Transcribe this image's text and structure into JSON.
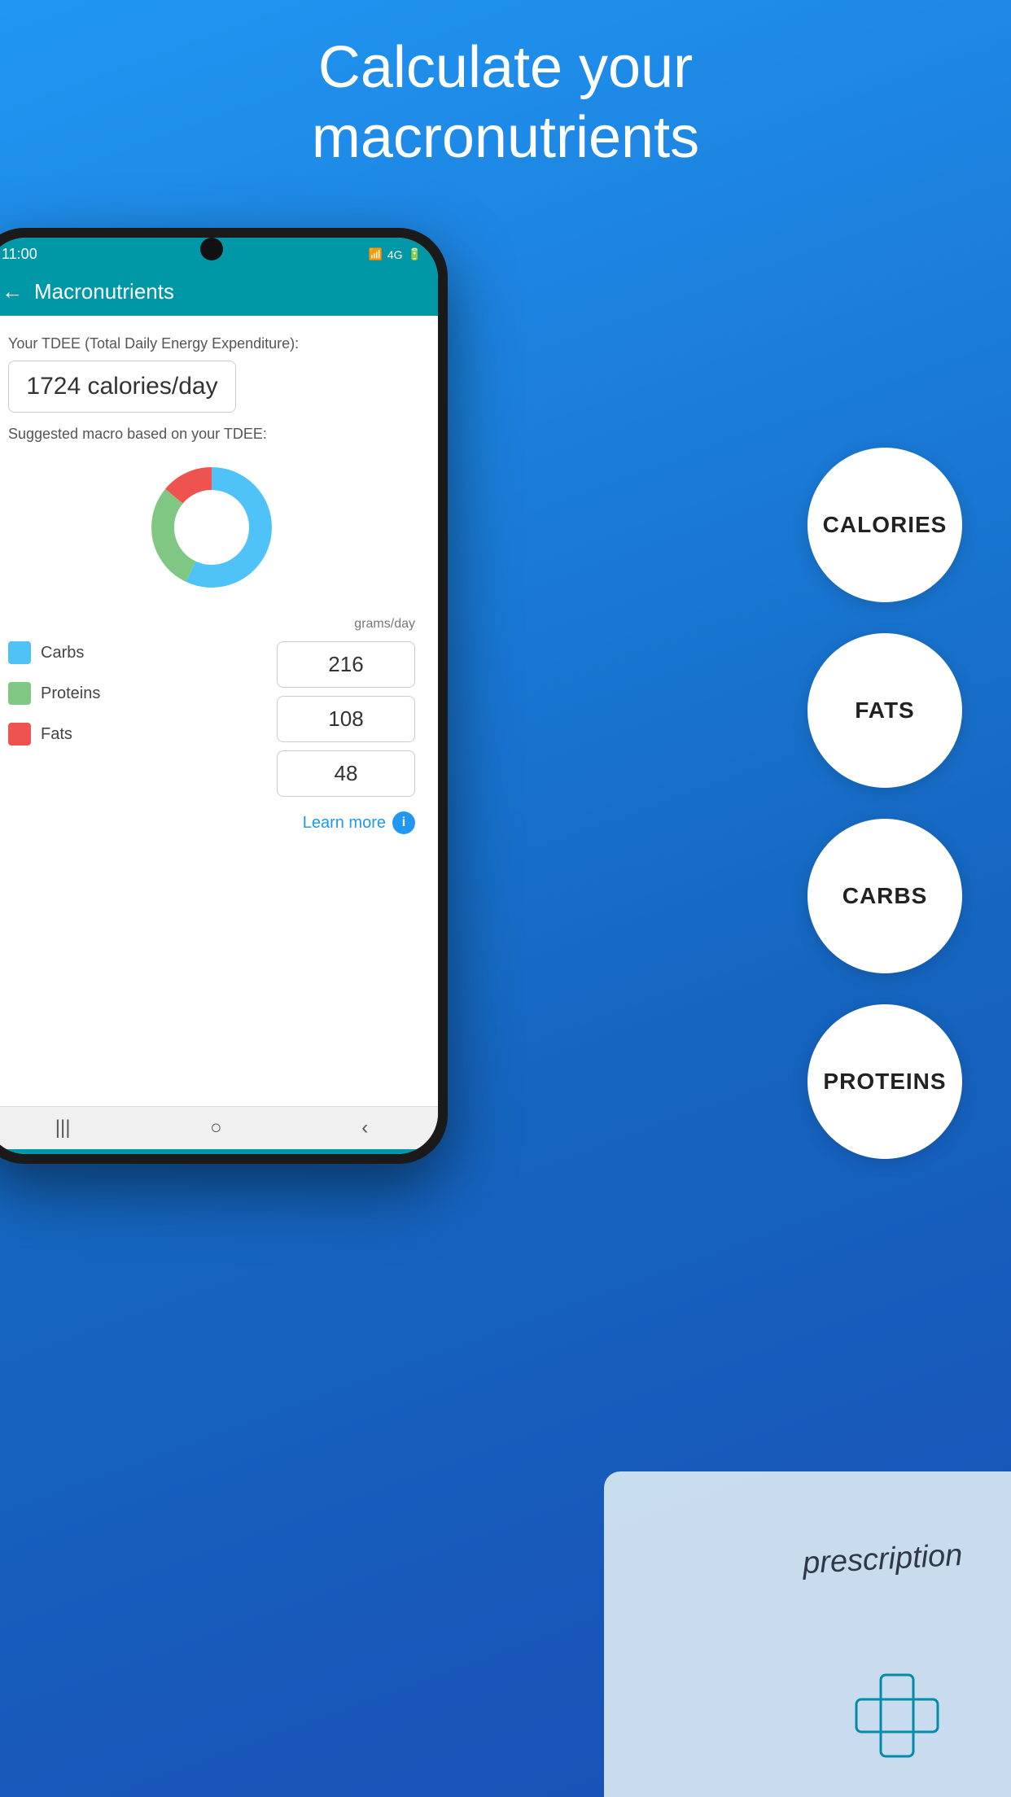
{
  "header": {
    "line1": "Calculate your",
    "line2": "macronutrients"
  },
  "circles": [
    {
      "label": "CALORIES"
    },
    {
      "label": "FATS"
    },
    {
      "label": "CARBS"
    },
    {
      "label": "PROTEINS"
    }
  ],
  "status_bar": {
    "time": "11:00",
    "signal": "4G"
  },
  "app_bar": {
    "title": "Macronutrients",
    "back": "←"
  },
  "content": {
    "tdee_label": "Your TDEE (Total Daily Energy Expenditure):",
    "tdee_value": "1724 calories/day",
    "suggested_label": "Suggested macro based on your TDEE:",
    "grams_label": "grams/day",
    "learn_more": "Learn more",
    "macros": {
      "carbs": {
        "label": "Carbs",
        "value": "216",
        "color": "#4fc3f7"
      },
      "proteins": {
        "label": "Proteins",
        "value": "108",
        "color": "#81c784"
      },
      "fats": {
        "label": "Fats",
        "value": "48",
        "color": "#ef5350"
      }
    }
  },
  "donut": {
    "carbs_pct": 57,
    "proteins_pct": 29,
    "fats_pct": 14
  },
  "bottom_nav": {
    "icons": [
      "|||",
      "○",
      "<"
    ]
  }
}
